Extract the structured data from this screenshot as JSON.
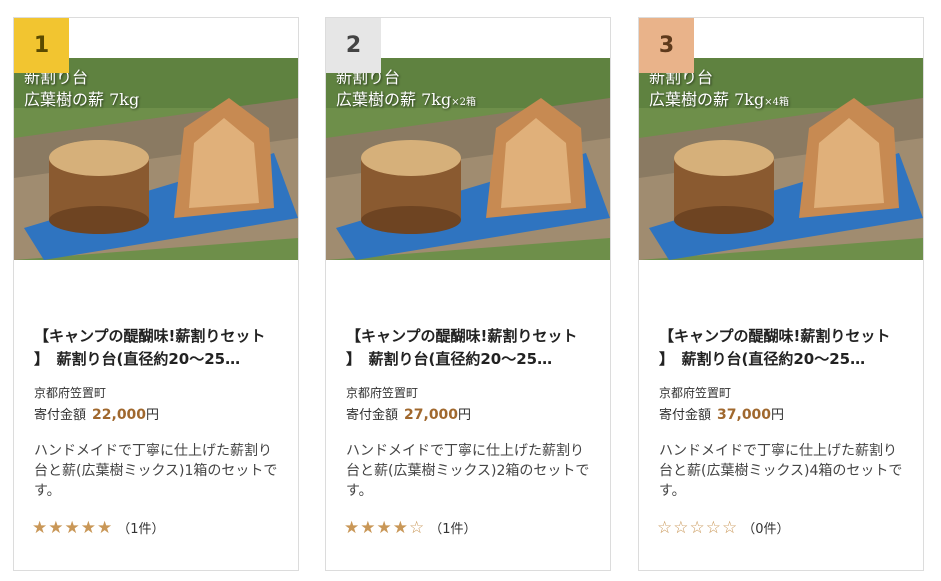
{
  "cards": [
    {
      "rank": "1",
      "caption_line1": "新割り台",
      "caption_line2": "広葉樹の薪 7kg",
      "caption_suffix": "",
      "title_line1": "【キャンプの醍醐味!薪割りセット",
      "title_line2": "】　薪割り台(直径約20～25…",
      "region": "京都府笠置町",
      "price_label": "寄付金額",
      "price_amount": "22,000",
      "price_unit": "円",
      "description": "ハンドメイドで丁寧に仕上げた薪割り台と薪(広葉樹ミックス)1箱のセットです。",
      "rating": 5,
      "review_count": "（1件）"
    },
    {
      "rank": "2",
      "caption_line1": "新割り台",
      "caption_line2": "広葉樹の薪 7kg",
      "caption_suffix": "×2箱",
      "title_line1": "【キャンプの醍醐味!薪割りセット",
      "title_line2": "】　薪割り台(直径約20～25…",
      "region": "京都府笠置町",
      "price_label": "寄付金額",
      "price_amount": "27,000",
      "price_unit": "円",
      "description": "ハンドメイドで丁寧に仕上げた薪割り台と薪(広葉樹ミックス)2箱のセットです。",
      "rating": 4,
      "review_count": "（1件）"
    },
    {
      "rank": "3",
      "caption_line1": "新割り台",
      "caption_line2": "広葉樹の薪 7kg",
      "caption_suffix": "×4箱",
      "title_line1": "【キャンプの醍醐味!薪割りセット",
      "title_line2": "】　薪割り台(直径約20～25…",
      "region": "京都府笠置町",
      "price_label": "寄付金額",
      "price_amount": "37,000",
      "price_unit": "円",
      "description": "ハンドメイドで丁寧に仕上げた薪割り台と薪(広葉樹ミックス)4箱のセットです。",
      "rating": 0,
      "review_count": "（0件）"
    }
  ],
  "colors": {
    "rank1": "#f2c530",
    "rank2": "#e6e6e6",
    "rank3": "#e9b38a",
    "price": "#a0682e",
    "star": "#c99757"
  },
  "icons": {
    "star_filled": "★",
    "star_empty": "☆"
  }
}
